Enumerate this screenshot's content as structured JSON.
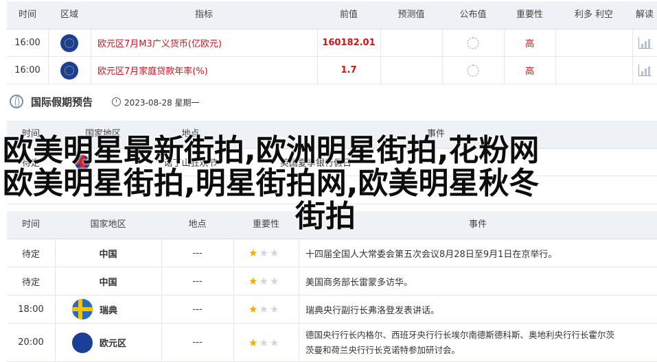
{
  "calendar": {
    "headers": [
      "时间",
      "区域",
      "指标",
      "前值",
      "预测值",
      "公布值",
      "重要性",
      "利多 利空",
      "解读"
    ],
    "rows": [
      {
        "time": "16:00",
        "indicator": "欧元区7月M3广义货币(亿欧元)",
        "prev": "160182.01",
        "importance": "高"
      },
      {
        "time": "16:00",
        "indicator": "欧元区7月家庭贷款年率(%)",
        "prev": "1.7",
        "importance": "高"
      }
    ]
  },
  "holiday": {
    "title": "国际假期预告",
    "date": "2023-08-28 星期一",
    "headers": [
      "时间",
      "国家地区",
      "地点",
      "重要性",
      "事件"
    ],
    "partial_row": {
      "time": "待定",
      "place": "诺丁山狂欢节",
      "event": "英国夏季银行假日"
    }
  },
  "events": {
    "headers": [
      "时间",
      "国家地区",
      "地点",
      "重要性",
      "事件"
    ],
    "rows": [
      {
        "time": "待定",
        "country": "中国",
        "place": "---",
        "stars": 1,
        "event": "十四届全国人大常委会第五次会议8月28日至9月1日在京举行。"
      },
      {
        "time": "待定",
        "country": "中国",
        "place": "---",
        "stars": 1,
        "event": "美国商务部长雷蒙多访华。"
      },
      {
        "time": "18:00",
        "country": "瑞典",
        "place": "---",
        "stars": 1,
        "event": "瑞典央行副行长弗洛登发表讲话。"
      },
      {
        "time": "20:00",
        "country": "欧元区",
        "place": "---",
        "stars": 1,
        "event_line1": "德国央行行长内格尔、西班牙央行行长埃尔南德斯德科斯、奥地利央行行长霍尔茨",
        "event_line2": "茨曼和荷兰央行行长克诺特参加研讨会。"
      }
    ]
  },
  "overlay": {
    "line1": "欧美明星最新街拍,欧洲明星街拍,花粉网",
    "line2": "欧美明星街拍,明星街拍网,欧美明星秋冬",
    "line3": "街拍"
  },
  "colors": {
    "header_bg": "#eef1f6",
    "accent_red": "#c8161d",
    "star": "#f2a900"
  }
}
